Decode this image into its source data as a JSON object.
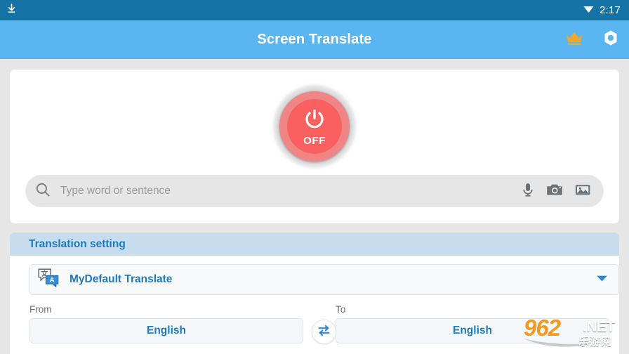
{
  "status_bar": {
    "download_icon": "download-icon",
    "wifi_icon": "wifi-icon",
    "time": "2:17",
    "background_color": "#1574a5"
  },
  "app_bar": {
    "title": "Screen Translate",
    "background_color": "#5ab5f0",
    "actions": [
      {
        "name": "crown-icon",
        "label": "Premium",
        "color": "#f5a623"
      },
      {
        "name": "gear-icon",
        "label": "Settings",
        "color": "#ffffff"
      }
    ]
  },
  "main_card": {
    "power_button": {
      "state_label": "OFF",
      "icon": "power-icon",
      "outer_color": "#f08585",
      "inner_color": "#f9605f"
    },
    "search": {
      "placeholder": "Type word or sentence",
      "value": "",
      "icon": "search-icon",
      "actions": [
        {
          "name": "microphone-icon",
          "label": "Voice input"
        },
        {
          "name": "camera-icon",
          "label": "Camera translate"
        },
        {
          "name": "gallery-icon",
          "label": "Image translate"
        }
      ]
    }
  },
  "translation_setting": {
    "header_title": "Translation setting",
    "header_color": "#c7ddee",
    "accent_color": "#1d7bbd",
    "default_profile": {
      "icon": "translate-icon",
      "label": "MyDefault Translate",
      "dropdown_icon": "chevron-down-icon"
    },
    "from": {
      "caption": "From",
      "value": "English"
    },
    "to": {
      "caption": "To",
      "value": "English"
    },
    "swap": {
      "icon": "swap-icon",
      "label": "Swap languages"
    }
  },
  "watermark": {
    "primary": "962",
    "secondary": ".NET",
    "tertiary": "乐游网"
  }
}
